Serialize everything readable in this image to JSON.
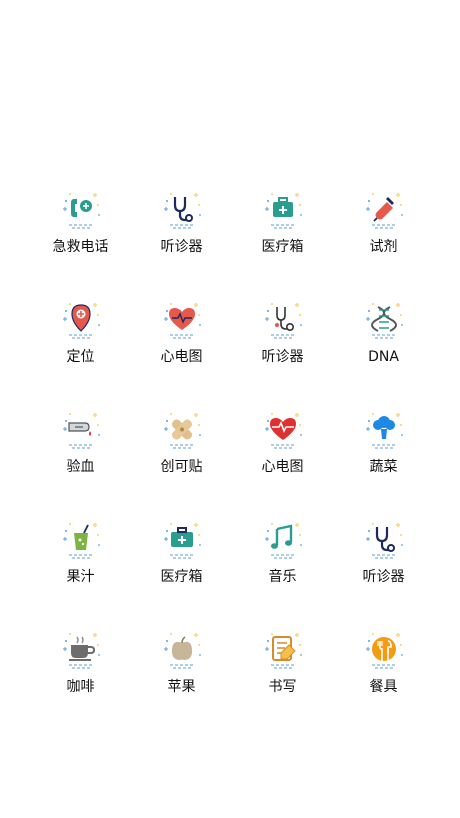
{
  "items": [
    {
      "label": "急救电话",
      "icon": "emergency-phone-icon"
    },
    {
      "label": "听诊器",
      "icon": "stethoscope-icon"
    },
    {
      "label": "医疗箱",
      "icon": "medical-kit-icon"
    },
    {
      "label": "试剂",
      "icon": "reagent-dropper-icon"
    },
    {
      "label": "定位",
      "icon": "location-pin-icon"
    },
    {
      "label": "心电图",
      "icon": "heart-ecg-icon"
    },
    {
      "label": "听诊器",
      "icon": "stethoscope-outline-icon"
    },
    {
      "label": "DNA",
      "icon": "dna-icon"
    },
    {
      "label": "验血",
      "icon": "blood-test-icon"
    },
    {
      "label": "创可贴",
      "icon": "bandage-icon"
    },
    {
      "label": "心电图",
      "icon": "heart-pulse-icon"
    },
    {
      "label": "蔬菜",
      "icon": "broccoli-icon"
    },
    {
      "label": "果汁",
      "icon": "juice-icon"
    },
    {
      "label": "医疗箱",
      "icon": "medical-box-icon"
    },
    {
      "label": "音乐",
      "icon": "music-note-icon"
    },
    {
      "label": "听诊器",
      "icon": "stethoscope-icon"
    },
    {
      "label": "咖啡",
      "icon": "coffee-cup-icon"
    },
    {
      "label": "苹果",
      "icon": "apple-icon"
    },
    {
      "label": "书写",
      "icon": "writing-notepad-icon"
    },
    {
      "label": "餐具",
      "icon": "tableware-icon"
    }
  ],
  "colors": {
    "teal": "#2a9d8f",
    "navy": "#1f2a5c",
    "red": "#e03131",
    "orange": "#f39c12",
    "dot_blue": "#5aa0d8",
    "dot_yellow": "#f4c14a"
  }
}
